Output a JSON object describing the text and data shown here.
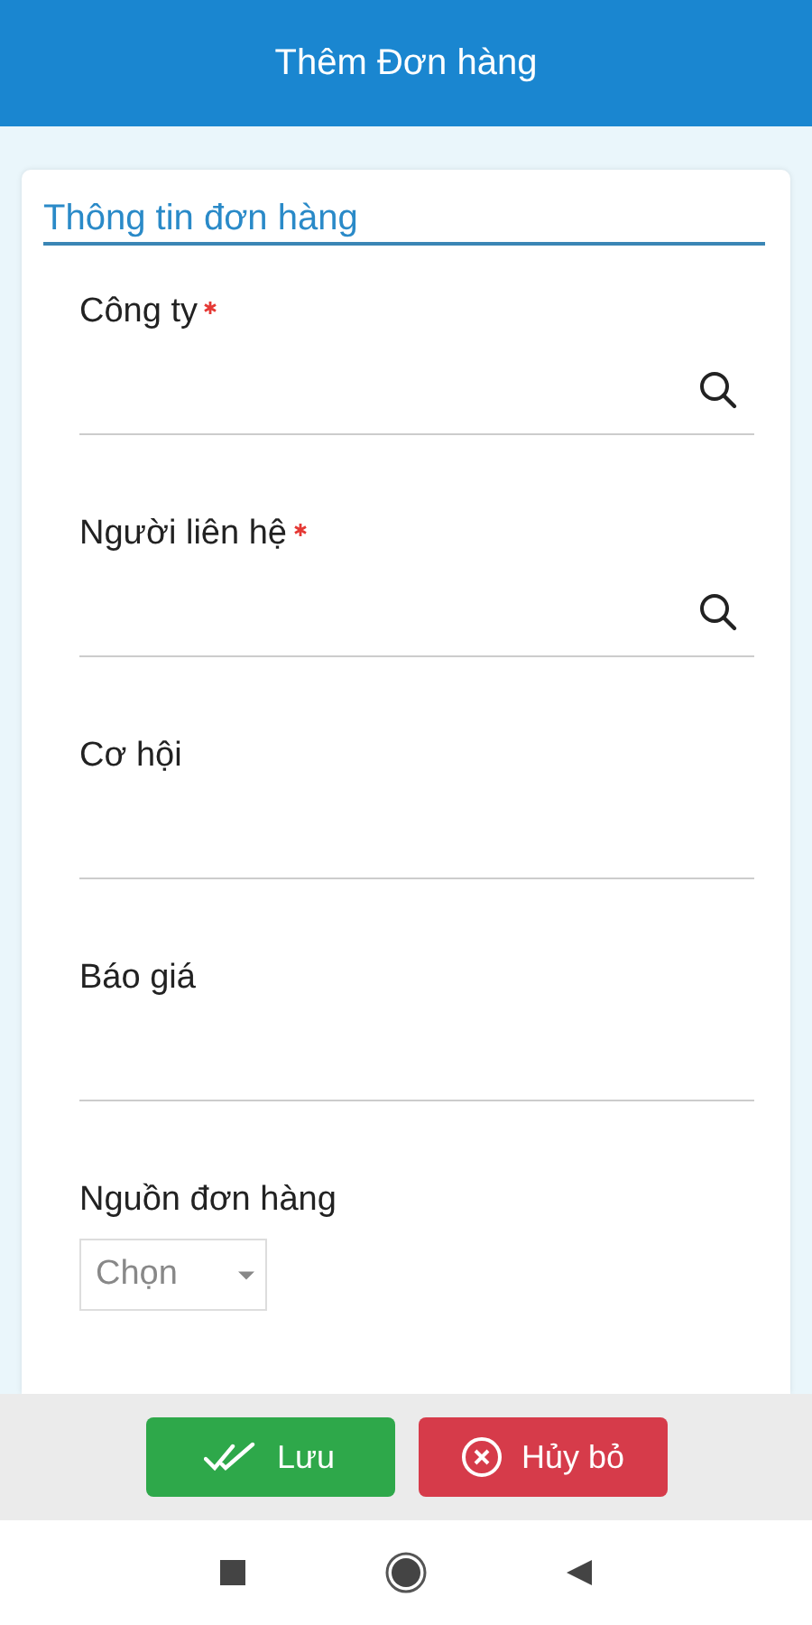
{
  "header": {
    "title": "Thêm Đơn hàng"
  },
  "section": {
    "title": "Thông tin đơn hàng"
  },
  "fields": [
    {
      "kind": "lookup",
      "label": "Công ty",
      "required": true
    },
    {
      "kind": "lookup",
      "label": "Người liên hệ",
      "required": true
    },
    {
      "kind": "text",
      "label": "Cơ hội",
      "required": false
    },
    {
      "kind": "text",
      "label": "Báo giá",
      "required": false
    },
    {
      "kind": "select",
      "label": "Nguồn đơn hàng",
      "required": false,
      "placeholder": "Chọn"
    }
  ],
  "buttons": [
    {
      "kind": "save",
      "label": "Lưu"
    },
    {
      "kind": "cancel",
      "label": "Hủy bỏ"
    }
  ]
}
